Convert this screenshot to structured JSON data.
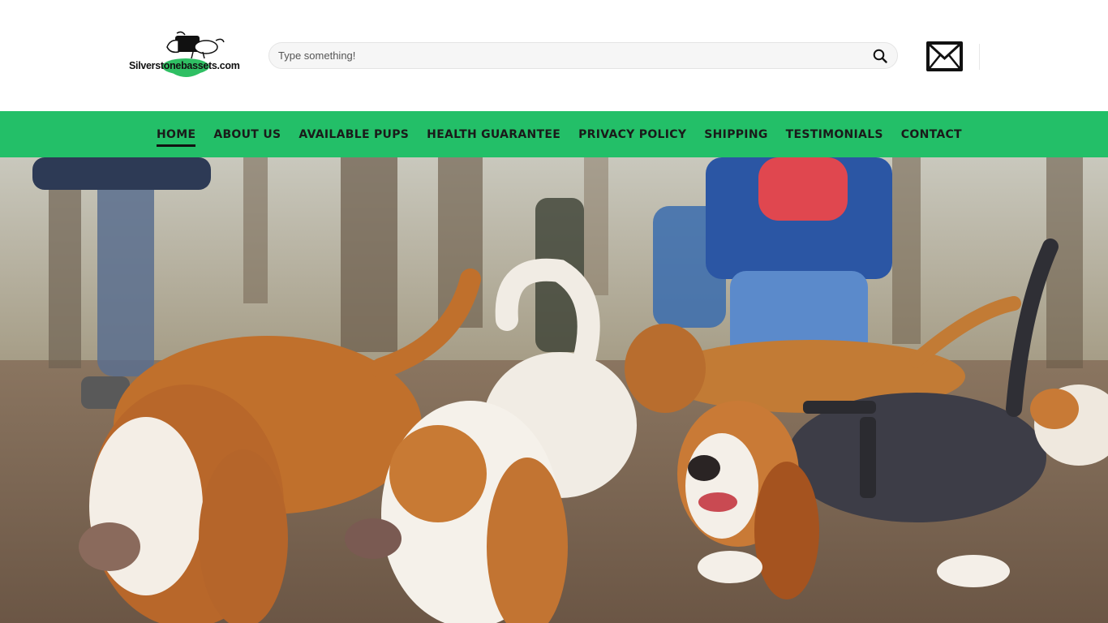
{
  "logo": {
    "text": "Silverstonebassets.com"
  },
  "search": {
    "placeholder": "Type something!"
  },
  "icons": {
    "search": "search-icon",
    "mail": "envelope-icon",
    "logo": "basset-dog-logo-icon"
  },
  "nav": {
    "items": [
      {
        "label": "HOME",
        "active": true
      },
      {
        "label": "ABOUT US"
      },
      {
        "label": "AVAILABLE PUPS"
      },
      {
        "label": "HEALTH GUARANTEE"
      },
      {
        "label": "PRIVACY POLICY"
      },
      {
        "label": "SHIPPING"
      },
      {
        "label": "TESTIMONIALS"
      },
      {
        "label": "CONTACT"
      }
    ]
  },
  "colors": {
    "nav_background": "#23bf68",
    "logo_green": "#2fbf63",
    "text_dark": "#1a1a1a"
  }
}
